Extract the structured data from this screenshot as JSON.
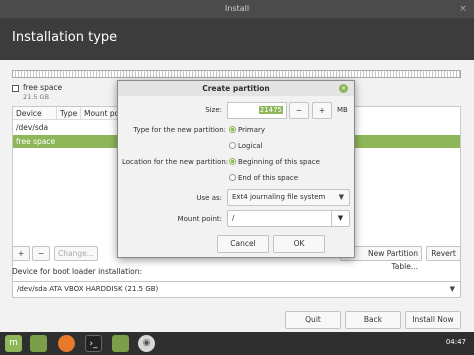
{
  "window": {
    "title": "Install"
  },
  "header": {
    "title": "Installation type"
  },
  "disk": {
    "legend_name": "free space",
    "legend_size": "21.5 GB",
    "columns": [
      "Device",
      "Type",
      "Mount point"
    ],
    "rows": [
      {
        "device": "/dev/sda",
        "selected": false
      },
      {
        "device": "free space",
        "selected": true
      }
    ]
  },
  "partition_buttons": {
    "add": "+",
    "remove": "−",
    "change": "Change...",
    "new_table": "New Partition Table...",
    "revert": "Revert"
  },
  "bootloader": {
    "label": "Device for boot loader installation:",
    "value": "/dev/sda ATA VBOX HARDDISK (21.5 GB)"
  },
  "nav_buttons": {
    "quit": "Quit",
    "back": "Back",
    "install_now": "Install Now"
  },
  "dialog": {
    "title": "Create partition",
    "size_label": "Size:",
    "size_value": "21475",
    "size_unit": "MB",
    "minus": "−",
    "plus": "+",
    "type_label": "Type for the new partition:",
    "type_options": [
      "Primary",
      "Logical"
    ],
    "type_selected": "Primary",
    "location_label": "Location for the new partition:",
    "location_options": [
      "Beginning of this space",
      "End of this space"
    ],
    "location_selected": "Beginning of this space",
    "use_as_label": "Use as:",
    "use_as_value": "Ext4 journaling file system",
    "mount_label": "Mount point:",
    "mount_value": "/",
    "cancel": "Cancel",
    "ok": "OK"
  },
  "taskbar": {
    "clock": "04:47",
    "icons": [
      "mint-menu-icon",
      "folder-icon",
      "firefox-icon",
      "terminal-icon",
      "files-icon",
      "installer-disc-icon"
    ]
  },
  "colors": {
    "accent": "#8fb75a",
    "header_bg": "#3c3c3c"
  }
}
